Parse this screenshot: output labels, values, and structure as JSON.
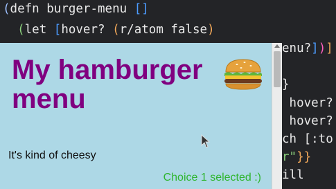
{
  "editor": {
    "line1": {
      "open": "(",
      "keyword": "defn",
      "name": "burger-menu",
      "args": "[]"
    },
    "line2": {
      "open": "(",
      "keyword": "let",
      "bracket": "[",
      "binding": "hover?",
      "call_open": "(",
      "call": "r/atom",
      "value": "false",
      "close": ")"
    },
    "right_lines": {
      "r1_a": "enu?",
      "r1_b": "]",
      "r1_c": ")",
      "r1_d": "]",
      "r2": "}",
      "r3": " hover?",
      "r4": " hover?",
      "r5": "ch [:to",
      "r6_a": "r\"",
      "r6_b": "}}",
      "r7": "ill"
    }
  },
  "preview": {
    "title": "My hamburger menu",
    "subtitle": "It's kind of cheesy",
    "status": "Choice 1 selected :)",
    "colors": {
      "background": "#add8e6",
      "title": "#800080",
      "status": "#2fb52f"
    }
  },
  "icons": {
    "menu": "hamburger-emoji-icon",
    "cursor": "mouse-pointer-icon"
  }
}
